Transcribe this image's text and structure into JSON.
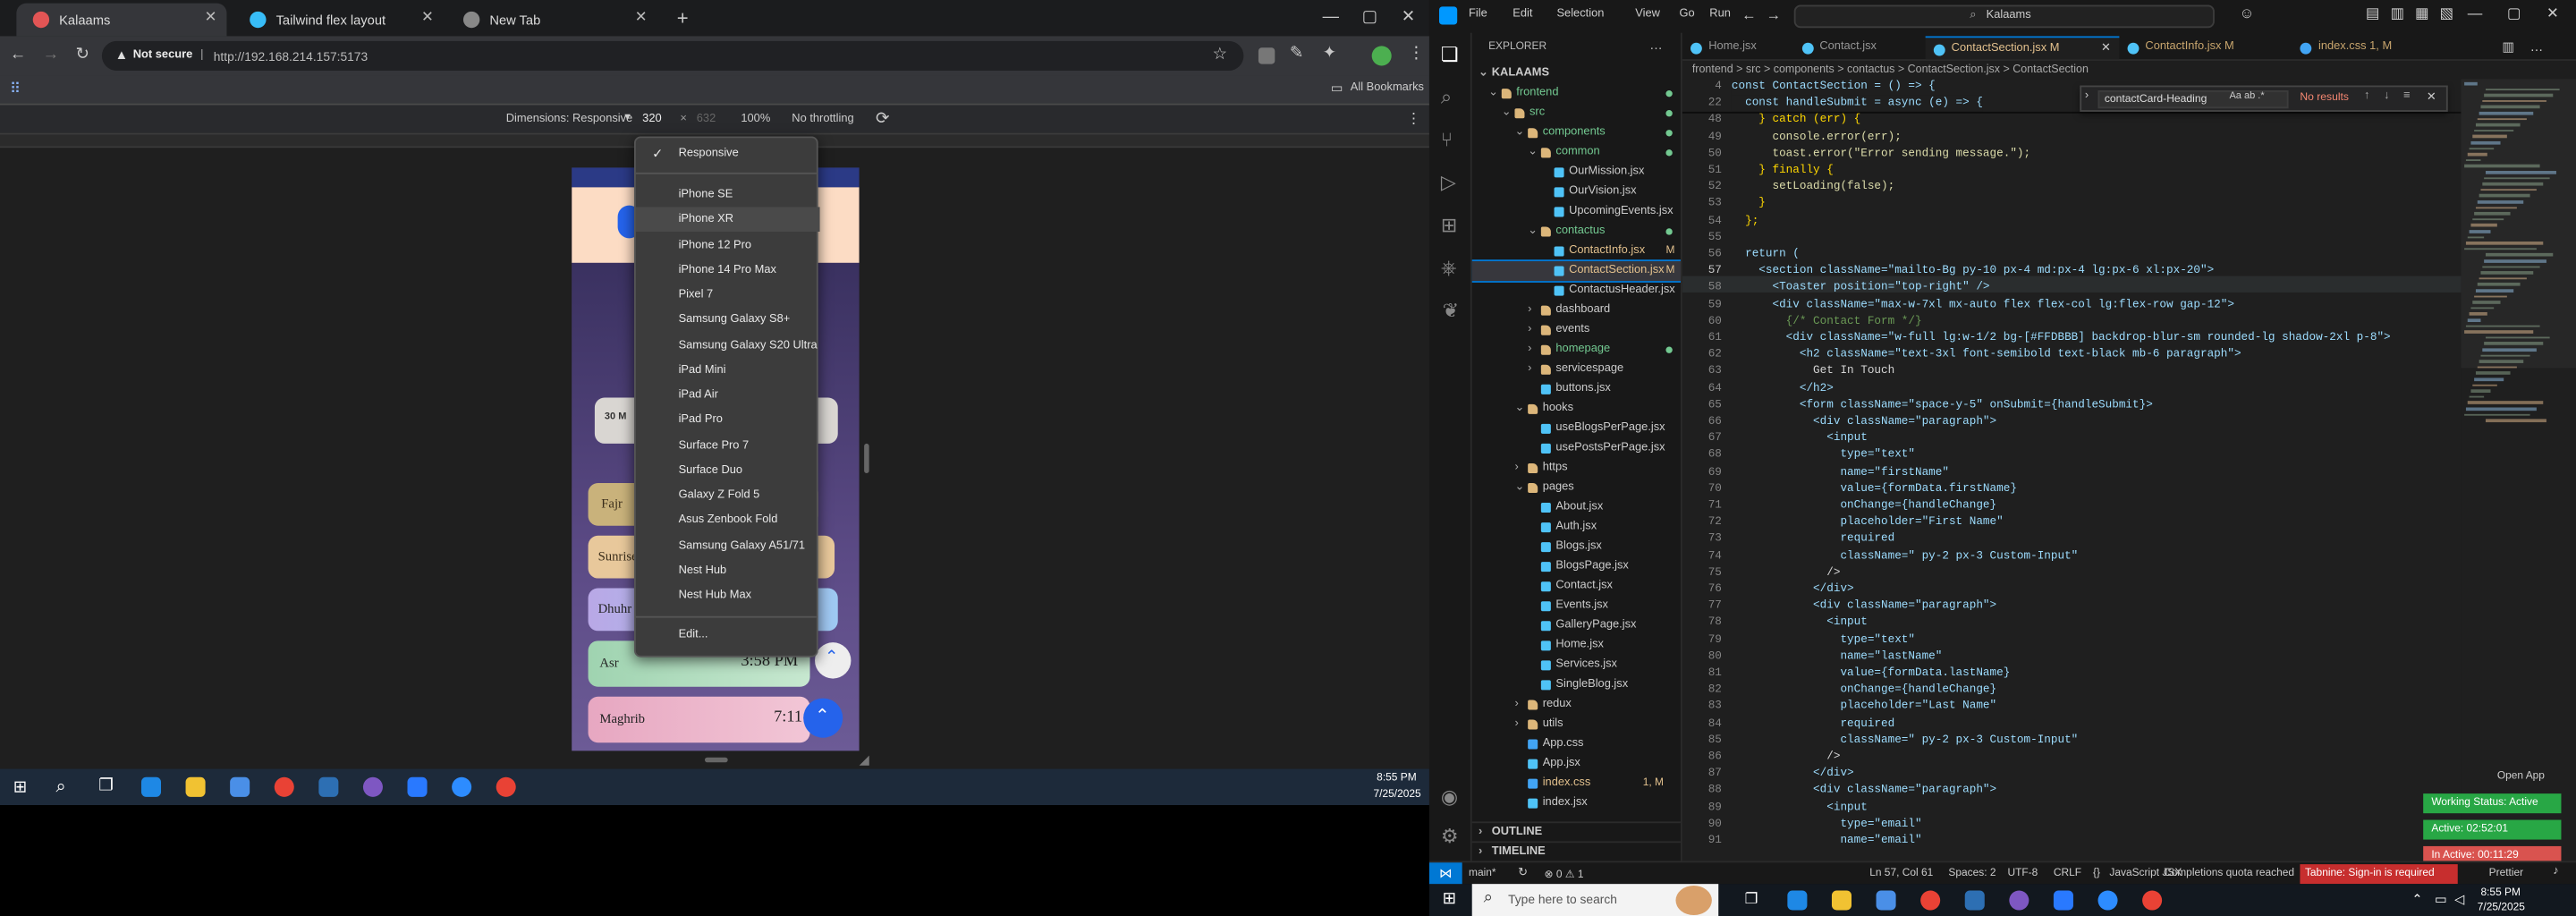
{
  "chrome": {
    "tabs": [
      {
        "label": "Kalaams",
        "active": true
      },
      {
        "label": "Tailwind flex layout",
        "active": false
      },
      {
        "label": "New Tab",
        "active": false
      }
    ],
    "new_tab": "+",
    "window_controls": [
      "—",
      "▢",
      "✕"
    ],
    "address": {
      "security": "Not secure",
      "url": "http://192.168.214.157:5173"
    },
    "all_bookmarks": "All Bookmarks",
    "devtools": {
      "dimensions": "Dimensions: Responsive",
      "width": "320",
      "times": "×",
      "height": "632",
      "zoom": "100%",
      "throttle": "No throttling"
    },
    "device_menu": {
      "checked": "Responsive",
      "devices": [
        "iPhone SE",
        "iPhone XR",
        "iPhone 12 Pro",
        "iPhone 14 Pro Max",
        "Pixel 7",
        "Samsung Galaxy S8+",
        "Samsung Galaxy S20 Ultra",
        "iPad Mini",
        "iPad Air",
        "iPad Pro",
        "Surface Pro 7",
        "Surface Duo",
        "Galaxy Z Fold 5",
        "Asus Zenbook Fold",
        "Samsung Galaxy A51/71",
        "Nest Hub",
        "Nest Hub Max"
      ],
      "edit": "Edit..."
    },
    "phone": {
      "date_chip": "30 M",
      "prayers": [
        {
          "name": "Fajr",
          "time": ""
        },
        {
          "name": "Sunrise",
          "time": ""
        },
        {
          "name": "Dhuhr",
          "time": ""
        },
        {
          "name": "Asr",
          "time": "3:58 PM"
        },
        {
          "name": "Maghrib",
          "time": "7:11"
        }
      ]
    },
    "taskbar_clock": {
      "time": "8:55 PM",
      "date": "7/25/2025"
    }
  },
  "vscode": {
    "title_menu": [
      "File",
      "Edit",
      "Selection",
      "View",
      "Go",
      "Run"
    ],
    "search": "Kalaams",
    "explorer_title": "EXPLORER",
    "workspace": "KALAAMS",
    "tree": [
      {
        "label": "frontend",
        "depth": 1,
        "kind": "folder-open",
        "mark": "dot"
      },
      {
        "label": "src",
        "depth": 2,
        "kind": "folder-open",
        "mark": "dot"
      },
      {
        "label": "components",
        "depth": 3,
        "kind": "folder-open",
        "mark": "dot"
      },
      {
        "label": "common",
        "depth": 4,
        "kind": "folder-open",
        "mark": "dot"
      },
      {
        "label": "OurMission.jsx",
        "depth": 5,
        "kind": "file",
        "mark": ""
      },
      {
        "label": "OurVision.jsx",
        "depth": 5,
        "kind": "file",
        "mark": ""
      },
      {
        "label": "UpcomingEvents.jsx",
        "depth": 5,
        "kind": "file",
        "mark": ""
      },
      {
        "label": "contactus",
        "depth": 4,
        "kind": "folder-open",
        "mark": "dot"
      },
      {
        "label": "ContactInfo.jsx",
        "depth": 5,
        "kind": "file",
        "mark": "M"
      },
      {
        "label": "ContactSection.jsx",
        "depth": 5,
        "kind": "file",
        "mark": "M",
        "selected": true
      },
      {
        "label": "ContactusHeader.jsx",
        "depth": 5,
        "kind": "file",
        "mark": ""
      },
      {
        "label": "dashboard",
        "depth": 4,
        "kind": "folder",
        "mark": ""
      },
      {
        "label": "events",
        "depth": 4,
        "kind": "folder",
        "mark": ""
      },
      {
        "label": "homepage",
        "depth": 4,
        "kind": "folder",
        "mark": "dot"
      },
      {
        "label": "servicespage",
        "depth": 4,
        "kind": "folder",
        "mark": ""
      },
      {
        "label": "buttons.jsx",
        "depth": 4,
        "kind": "file",
        "mark": ""
      },
      {
        "label": "hooks",
        "depth": 3,
        "kind": "folder-open",
        "mark": ""
      },
      {
        "label": "useBlogsPerPage.jsx",
        "depth": 4,
        "kind": "file",
        "mark": ""
      },
      {
        "label": "usePostsPerPage.jsx",
        "depth": 4,
        "kind": "file",
        "mark": ""
      },
      {
        "label": "https",
        "depth": 3,
        "kind": "folder",
        "mark": ""
      },
      {
        "label": "pages",
        "depth": 3,
        "kind": "folder-open",
        "mark": ""
      },
      {
        "label": "About.jsx",
        "depth": 4,
        "kind": "file",
        "mark": ""
      },
      {
        "label": "Auth.jsx",
        "depth": 4,
        "kind": "file",
        "mark": ""
      },
      {
        "label": "Blogs.jsx",
        "depth": 4,
        "kind": "file",
        "mark": ""
      },
      {
        "label": "BlogsPage.jsx",
        "depth": 4,
        "kind": "file",
        "mark": ""
      },
      {
        "label": "Contact.jsx",
        "depth": 4,
        "kind": "file",
        "mark": ""
      },
      {
        "label": "Events.jsx",
        "depth": 4,
        "kind": "file",
        "mark": ""
      },
      {
        "label": "GalleryPage.jsx",
        "depth": 4,
        "kind": "file",
        "mark": ""
      },
      {
        "label": "Home.jsx",
        "depth": 4,
        "kind": "file",
        "mark": ""
      },
      {
        "label": "Services.jsx",
        "depth": 4,
        "kind": "file",
        "mark": ""
      },
      {
        "label": "SingleBlog.jsx",
        "depth": 4,
        "kind": "file",
        "mark": ""
      },
      {
        "label": "redux",
        "depth": 3,
        "kind": "folder",
        "mark": ""
      },
      {
        "label": "utils",
        "depth": 3,
        "kind": "folder",
        "mark": ""
      },
      {
        "label": "App.css",
        "depth": 3,
        "kind": "file",
        "mark": ""
      },
      {
        "label": "App.jsx",
        "depth": 3,
        "kind": "file",
        "mark": ""
      },
      {
        "label": "index.css",
        "depth": 3,
        "kind": "file",
        "mark": "1, M"
      },
      {
        "label": "index.jsx",
        "depth": 3,
        "kind": "file",
        "mark": ""
      }
    ],
    "outline": "OUTLINE",
    "timeline": "TIMELINE",
    "editor_tabs": [
      {
        "label": "Home.jsx",
        "active": false
      },
      {
        "label": "Contact.jsx",
        "active": false
      },
      {
        "label": "ContactSection.jsx M",
        "active": true
      },
      {
        "label": "ContactInfo.jsx M",
        "active": false
      },
      {
        "label": "index.css 1, M",
        "active": false
      }
    ],
    "breadcrumb": "frontend > src > components > contactus > ContactSection.jsx > ContactSection",
    "find": {
      "query": "contactCard-Heading",
      "result": "No results",
      "options": "Aa  ab  .*"
    },
    "code_lines": [
      {
        "n": "4",
        "t": "const ContactSection = () => {"
      },
      {
        "n": "22",
        "t": "  const handleSubmit = async (e) => {"
      },
      {
        "n": "48",
        "t": "    } catch (err) {"
      },
      {
        "n": "49",
        "t": "      console.error(err);"
      },
      {
        "n": "50",
        "t": "      toast.error(\"Error sending message.\");"
      },
      {
        "n": "51",
        "t": "    } finally {"
      },
      {
        "n": "52",
        "t": "      setLoading(false);"
      },
      {
        "n": "53",
        "t": "    }"
      },
      {
        "n": "54",
        "t": "  };"
      },
      {
        "n": "55",
        "t": ""
      },
      {
        "n": "56",
        "t": "  return ("
      },
      {
        "n": "57",
        "t": "    <section className=\"mailto-Bg py-10 px-4 md:px-4 lg:px-6 xl:px-20\">"
      },
      {
        "n": "58",
        "t": "      <Toaster position=\"top-right\" />"
      },
      {
        "n": "59",
        "t": "      <div className=\"max-w-7xl mx-auto flex flex-col lg:flex-row gap-12\">"
      },
      {
        "n": "60",
        "t": "        {/* Contact Form */}"
      },
      {
        "n": "61",
        "t": "        <div className=\"w-full lg:w-1/2 bg-[#FFDBBB] backdrop-blur-sm rounded-lg shadow-2xl p-8\">"
      },
      {
        "n": "62",
        "t": "          <h2 className=\"text-3xl font-semibold text-black mb-6 paragraph\">"
      },
      {
        "n": "63",
        "t": "            Get In Touch"
      },
      {
        "n": "64",
        "t": "          </h2>"
      },
      {
        "n": "65",
        "t": "          <form className=\"space-y-5\" onSubmit={handleSubmit}>"
      },
      {
        "n": "66",
        "t": "            <div className=\"paragraph\">"
      },
      {
        "n": "67",
        "t": "              <input"
      },
      {
        "n": "68",
        "t": "                type=\"text\""
      },
      {
        "n": "69",
        "t": "                name=\"firstName\""
      },
      {
        "n": "70",
        "t": "                value={formData.firstName}"
      },
      {
        "n": "71",
        "t": "                onChange={handleChange}"
      },
      {
        "n": "72",
        "t": "                placeholder=\"First Name\""
      },
      {
        "n": "73",
        "t": "                required"
      },
      {
        "n": "74",
        "t": "                className=\" py-2 px-3 Custom-Input\""
      },
      {
        "n": "75",
        "t": "              />"
      },
      {
        "n": "76",
        "t": "            </div>"
      },
      {
        "n": "77",
        "t": "            <div className=\"paragraph\">"
      },
      {
        "n": "78",
        "t": "              <input"
      },
      {
        "n": "79",
        "t": "                type=\"text\""
      },
      {
        "n": "80",
        "t": "                name=\"lastName\""
      },
      {
        "n": "81",
        "t": "                value={formData.lastName}"
      },
      {
        "n": "82",
        "t": "                onChange={handleChange}"
      },
      {
        "n": "83",
        "t": "                placeholder=\"Last Name\""
      },
      {
        "n": "84",
        "t": "                required"
      },
      {
        "n": "85",
        "t": "                className=\" py-2 px-3 Custom-Input\""
      },
      {
        "n": "86",
        "t": "              />"
      },
      {
        "n": "87",
        "t": "            </div>"
      },
      {
        "n": "88",
        "t": "            <div className=\"paragraph\">"
      },
      {
        "n": "89",
        "t": "              <input"
      },
      {
        "n": "90",
        "t": "                type=\"email\""
      },
      {
        "n": "91",
        "t": "                name=\"email\""
      }
    ],
    "open_app": "Open App",
    "status": {
      "branch": "main*",
      "problems": "⊗ 0 ⚠ 1",
      "position": "Ln 57, Col 61",
      "spaces": "Spaces: 2",
      "encoding": "UTF-8",
      "eol": "CRLF",
      "language": "JavaScript JSX",
      "quota": "Completions quota reached",
      "tabnine": "Tabnine: Sign-in is required",
      "prettier": "Prettier"
    },
    "working": {
      "status": "Working Status: Active",
      "active": "Active: 02:52:01",
      "inactive": "In Active: 00:11:29"
    }
  },
  "windows": {
    "search_placeholder": "Type here to search",
    "time": "8:55 PM",
    "date": "7/25/2025"
  },
  "colors": {
    "vscode_blue": "#007acc",
    "chrome_bg": "#202124",
    "active_green": "#28a745",
    "inactive_red": "#d9534f"
  }
}
